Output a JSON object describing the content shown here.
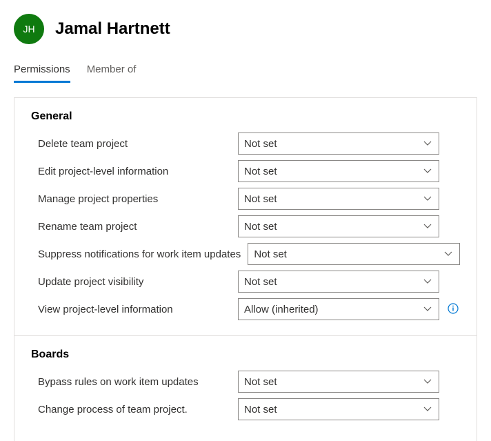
{
  "user": {
    "initials": "JH",
    "name": "Jamal Hartnett"
  },
  "tabs": {
    "permissions": "Permissions",
    "memberof": "Member of"
  },
  "sections": {
    "general": {
      "title": "General",
      "items": [
        {
          "label": "Delete team project",
          "value": "Not set",
          "layout": "standard",
          "info": false
        },
        {
          "label": "Edit project-level information",
          "value": "Not set",
          "layout": "standard",
          "info": false
        },
        {
          "label": "Manage project properties",
          "value": "Not set",
          "layout": "standard",
          "info": false
        },
        {
          "label": "Rename team project",
          "value": "Not set",
          "layout": "standard",
          "info": false
        },
        {
          "label": "Suppress notifications for work item updates",
          "value": "Not set",
          "layout": "long",
          "info": false
        },
        {
          "label": "Update project visibility",
          "value": "Not set",
          "layout": "standard",
          "info": false
        },
        {
          "label": "View project-level information",
          "value": "Allow (inherited)",
          "layout": "standard",
          "info": true
        }
      ]
    },
    "boards": {
      "title": "Boards",
      "items": [
        {
          "label": "Bypass rules on work item updates",
          "value": "Not set",
          "layout": "standard",
          "info": false
        },
        {
          "label": "Change process of team project.",
          "value": "Not set",
          "layout": "standard",
          "info": false
        }
      ]
    }
  }
}
